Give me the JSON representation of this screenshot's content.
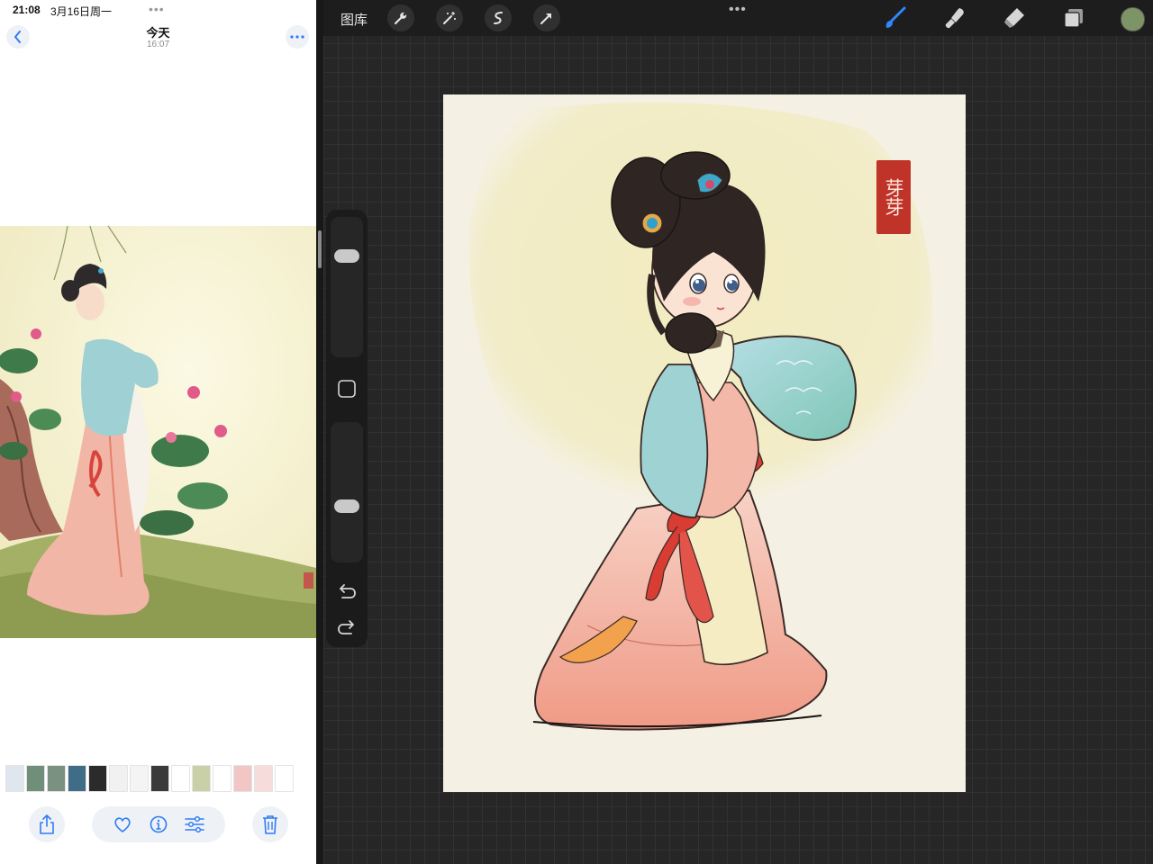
{
  "status": {
    "time": "21:08",
    "date": "3月16日周一"
  },
  "photos": {
    "title": "今天",
    "subtitle": "16:07",
    "icons": {
      "back": "chevron-left-icon",
      "more": "ellipsis-icon",
      "share": "share-icon",
      "favorite": "heart-icon",
      "info": "info-icon",
      "adjust": "sliders-icon",
      "delete": "trash-icon"
    },
    "thumbnails": [
      {
        "color": "#dfe6ee"
      },
      {
        "color": "#6f8f7a"
      },
      {
        "color": "#7a9080"
      },
      {
        "color": "#3f6d87"
      },
      {
        "color": "#2b2b2b"
      },
      {
        "color": "#f1f1f1"
      },
      {
        "color": "#f4f4f4"
      },
      {
        "color": "#3a3a3a"
      },
      {
        "color": "#ffffff"
      },
      {
        "color": "#c9d0a7"
      },
      {
        "color": "#ffffff"
      },
      {
        "color": "#f3c6c6"
      },
      {
        "color": "#f7dcdc"
      },
      {
        "color": "#ffffff"
      }
    ]
  },
  "procreate": {
    "gallery_label": "图库",
    "tools_left": [
      "wrench-icon",
      "magic-wand-icon",
      "selection-icon",
      "transform-arrow-icon"
    ],
    "tools_right": [
      "brush-icon",
      "smudge-icon",
      "eraser-icon",
      "layers-icon"
    ],
    "active_tool": "brush-icon",
    "accent_color": "#2f86ff",
    "current_color": "#7d9467",
    "seal_text": "芽芽"
  }
}
